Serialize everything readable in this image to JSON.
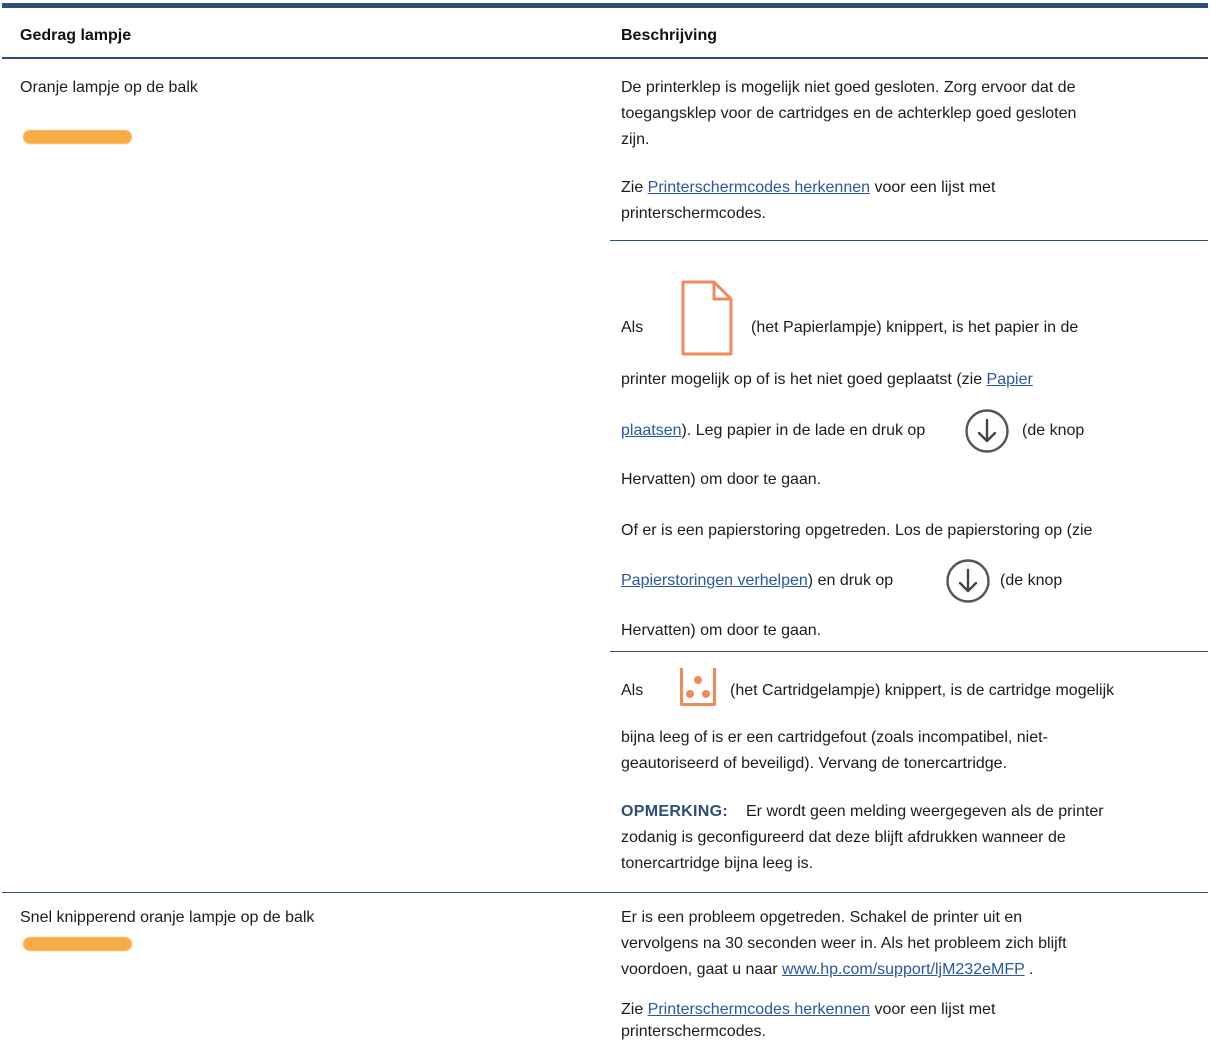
{
  "table": {
    "headers": {
      "behavior": "Gedrag lampje",
      "description": "Beschrijving"
    },
    "row1": {
      "label": "Oranje lampje op de balk",
      "block1": {
        "lines": [
          "De printerklep is mogelijk niet goed gesloten. Zorg ervoor dat de",
          "toegangsklep voor de cartridges en de achterklep goed gesloten",
          "zijn."
        ],
        "see_prefix": "Zie ",
        "see_link": "Printerschermcodes herkennen",
        "see_suffix": " voor een lijst met",
        "see_line2": "printerschermcodes."
      },
      "block2": {
        "als": "Als",
        "after_icon": "(het Papierlampje) knippert, is het papier in de",
        "line2_prefix": "printer mogelijk op of is het niet goed geplaatst (zie ",
        "link_papier_1": "Papier",
        "link_papier_2": "plaatsen",
        "line3_rest": "). Leg papier in de lade en druk op",
        "knop": "(de knop",
        "hervatten": "Hervatten) om door te gaan.",
        "of_line": "Of er is een papierstoring opgetreden. Los de papierstoring op (zie",
        "link_storingen": "Papierstoringen verhelpen",
        "storing_rest": ") en druk op",
        "knop2": "(de knop",
        "hervatten2": "Hervatten) om door te gaan."
      },
      "block3": {
        "als": "Als",
        "after_icon": "(het Cartridgelampje) knippert, is de cartridge mogelijk",
        "line2": "bijna leeg of is er een cartridgefout (zoals incompatibel, niet-",
        "line3": "geautoriseerd of beveiligd). Vervang de tonercartridge.",
        "note_label": "OPMERKING:",
        "note_line1": "Er wordt geen melding weergegeven als de printer",
        "note_line2": "zodanig is geconfigureerd dat deze blijft afdrukken wanneer de",
        "note_line3": "tonercartridge bijna leeg is."
      }
    },
    "row2": {
      "label": "Snel knipperend oranje lampje op de balk",
      "lines": [
        "Er is een probleem opgetreden. Schakel de printer uit en",
        "vervolgens na 30 seconden weer in. Als het probleem zich blijft"
      ],
      "line3_prefix": "voordoen, gaat u naar ",
      "url_link": "www.hp.com/support/ljM232eMFP",
      "line3_suffix": " .",
      "see_prefix": "Zie ",
      "see_link": "Printerschermcodes herkennen",
      "see_suffix": " voor een lijst met",
      "see_line2": "printerschermcodes."
    }
  },
  "colors": {
    "rule": "#2e4e7a",
    "link": "#2857a4",
    "amber_light": "#f6ad45",
    "icon_orange": "#f08a5b",
    "note_label": "#2e4e7a"
  },
  "icons": [
    "amber-light-bar-icon",
    "paper-light-icon",
    "resume-button-icon",
    "cartridge-light-icon"
  ]
}
